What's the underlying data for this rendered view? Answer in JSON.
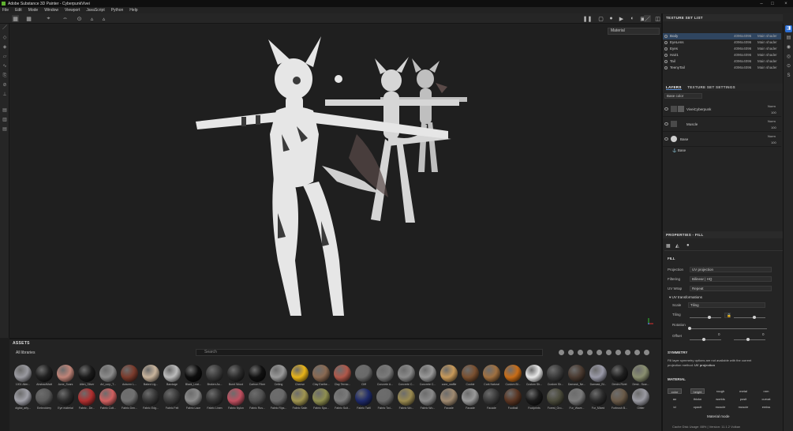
{
  "app": {
    "title": "Adobe Substance 3D Painter - CyberpunkVivei"
  },
  "menu": [
    "File",
    "Edit",
    "Mode",
    "Window",
    "Viewport",
    "JavaScript",
    "Python",
    "Help"
  ],
  "viewport": {
    "material_select": "Material"
  },
  "texture_set_list": {
    "title": "TEXTURE SET LIST",
    "rows": [
      {
        "name": "Body",
        "res": "4096x4096",
        "shader": "Main shader",
        "selected": true
      },
      {
        "name": "EyeLens",
        "res": "4096x4096",
        "shader": "Main shader"
      },
      {
        "name": "Eyes",
        "res": "4096x4096",
        "shader": "Main shader"
      },
      {
        "name": "Hair1",
        "res": "4096x4096",
        "shader": "Main shader"
      },
      {
        "name": "Tail",
        "res": "4096x4096",
        "shader": "Main shader"
      },
      {
        "name": "TeenyTail",
        "res": "4096x4096",
        "shader": "Main shader"
      }
    ]
  },
  "layers": {
    "tab_layers": "LAYERS",
    "tab_tss": "TEXTURE SET SETTINGS",
    "channel_select": "Base color",
    "rows": [
      {
        "name": "ViveiCyberpunk",
        "blend": "Norm",
        "opacity": "100"
      },
      {
        "name": "Muscle",
        "blend": "Norm",
        "opacity": "100"
      },
      {
        "name": "Base",
        "blend": "Norm",
        "opacity": "100"
      }
    ],
    "sub_row": "Base"
  },
  "properties": {
    "title": "PROPERTIES - FILL",
    "section_fill": "FILL",
    "projection_label": "Projection",
    "projection_value": "UV projection",
    "filtering_label": "Filtering",
    "filtering_value": "Bilinear | HQ",
    "uvwrap_label": "UV Wrap",
    "uvwrap_value": "Repeat",
    "uv_transform": "UV transformations",
    "scale_label": "Scale",
    "scale_value": "Tiling",
    "tiling_label": "Tiling",
    "rotation_label": "Rotation",
    "offset_label": "Offset",
    "offset_x": "0",
    "offset_y": "0",
    "symmetry_title": "SYMMETRY",
    "symmetry_text1": "Fill layer symmetry options are not available with the current",
    "symmetry_text2": "projection method:",
    "symmetry_text3": "UV projection",
    "material_title": "MATERIAL",
    "channels": [
      {
        "label": "color",
        "on": true
      },
      {
        "label": "height",
        "on": true
      },
      {
        "label": "rough",
        "on": false
      },
      {
        "label": "metal",
        "on": false
      },
      {
        "label": "nrm",
        "on": false
      },
      {
        "label": "ao",
        "on": false
      },
      {
        "label": "thickn",
        "on": false
      },
      {
        "label": "worlds",
        "on": false
      },
      {
        "label": "posit",
        "on": false
      },
      {
        "label": "curvat",
        "on": false
      },
      {
        "label": "id",
        "on": false
      },
      {
        "label": "opacit",
        "on": false
      },
      {
        "label": "muscle",
        "on": false
      },
      {
        "label": "muscle",
        "on": false
      },
      {
        "label": "emiss",
        "on": false
      }
    ],
    "material_mode": "Material mode"
  },
  "assets": {
    "title": "ASSETS",
    "library": "All libraries",
    "search_placeholder": "Search",
    "items": [
      {
        "label": "1001 Alter...",
        "color": "#9a9aa0"
      },
      {
        "label": "AbstractMatt",
        "color": "#202020"
      },
      {
        "label": "Acne_Scars",
        "color": "#c08478"
      },
      {
        "label": "Alien_Silver",
        "color": "#1a1a1a"
      },
      {
        "label": "Art_corp_T...",
        "color": "#8c8c8c"
      },
      {
        "label": "Autumn L...",
        "color": "#7a3b2c"
      },
      {
        "label": "Baked Lig...",
        "color": "#c9b49c"
      },
      {
        "label": "Bandage",
        "color": "#bcbcbc"
      },
      {
        "label": "Black_Leat...",
        "color": "#0d0d0d"
      },
      {
        "label": "Broken As...",
        "color": "#3a3a3a"
      },
      {
        "label": "Burnt Wood",
        "color": "#2a2a2a"
      },
      {
        "label": "Carbon Fiber",
        "color": "#111111"
      },
      {
        "label": "Ceiling",
        "color": "#9a9a9a"
      },
      {
        "label": "Cheese",
        "color": "#e8b419"
      },
      {
        "label": "Clay Earthe...",
        "color": "#8a6a52"
      },
      {
        "label": "Clay Terrac...",
        "color": "#b0584a"
      },
      {
        "label": "Cliff",
        "color": "#6a6a6a"
      },
      {
        "label": "Concrete A...",
        "color": "#7a7a7a"
      },
      {
        "label": "Concrete C...",
        "color": "#8a8a8a"
      },
      {
        "label": "Concrete C...",
        "color": "#999999"
      },
      {
        "label": "cone_waffle",
        "color": "#c89a5a"
      },
      {
        "label": "Cookie",
        "color": "#7a5030"
      },
      {
        "label": "Cork Natural",
        "color": "#a07040"
      },
      {
        "label": "Custom Bl...",
        "color": "#c86d18"
      },
      {
        "label": "Custom Sh...",
        "color": "#e8e8e8"
      },
      {
        "label": "Custom Sh...",
        "color": "#3a3a3a"
      },
      {
        "label": "Damask_Ne...",
        "color": "#4a3a30"
      },
      {
        "label": "Damask_Bl...",
        "color": "#9a9aa8"
      },
      {
        "label": "Denim Rivet",
        "color": "#1e1e1e"
      },
      {
        "label": "Desk - Scar...",
        "color": "#8a8f70"
      },
      {
        "label": "digital_arty...",
        "color": "#a0a0a8"
      },
      {
        "label": "Embroidery",
        "color": "#5a5a5a"
      },
      {
        "label": "Eye material",
        "color": "#2a2a2a"
      },
      {
        "label": "Fabric - De...",
        "color": "#b03030"
      },
      {
        "label": "Fabric Cott...",
        "color": "#d06060"
      },
      {
        "label": "Fabric Den...",
        "color": "#707070"
      },
      {
        "label": "Fabric Edg...",
        "color": "#353535"
      },
      {
        "label": "Fabric Felt",
        "color": "#3a3a3a"
      },
      {
        "label": "Fabric Lace",
        "color": "#8a8a8a"
      },
      {
        "label": "Fabric Linen",
        "color": "#333333"
      },
      {
        "label": "Fabric Nylon",
        "color": "#c05060"
      },
      {
        "label": "Fabric Rus...",
        "color": "#505050"
      },
      {
        "label": "Fabric Rips...",
        "color": "#6a6a6a"
      },
      {
        "label": "Fabric Satin",
        "color": "#a09550"
      },
      {
        "label": "Fabric Spa...",
        "color": "#8f8f50"
      },
      {
        "label": "Fabric Suit...",
        "color": "#7a7a7a"
      },
      {
        "label": "Fabric Twill",
        "color": "#1e2a6a"
      },
      {
        "label": "Fabric Twi...",
        "color": "#6a6a6a"
      },
      {
        "label": "Fabric Wo...",
        "color": "#9a8a50"
      },
      {
        "label": "Fabric Wo...",
        "color": "#8a8a8a"
      },
      {
        "label": "Facade",
        "color": "#a08a70"
      },
      {
        "label": "Facade",
        "color": "#9a9a9a"
      },
      {
        "label": "Facade",
        "color": "#3a3a3a"
      },
      {
        "label": "Football",
        "color": "#5a3522"
      },
      {
        "label": "Footprints",
        "color": "#1a1a1a"
      },
      {
        "label": "Forest_Gro...",
        "color": "#4a4a3a"
      },
      {
        "label": "Fur_Wave...",
        "color": "#7a7a7a"
      },
      {
        "label": "Fur_Mixed",
        "color": "#2a2a2a"
      },
      {
        "label": "Furbrush B...",
        "color": "#6a5a48"
      },
      {
        "label": "Glitter",
        "color": "#9a9aa2"
      }
    ]
  },
  "status": {
    "text": "Cache Disk Usage: 88% | Version: 11.1.2 Vulkan"
  }
}
